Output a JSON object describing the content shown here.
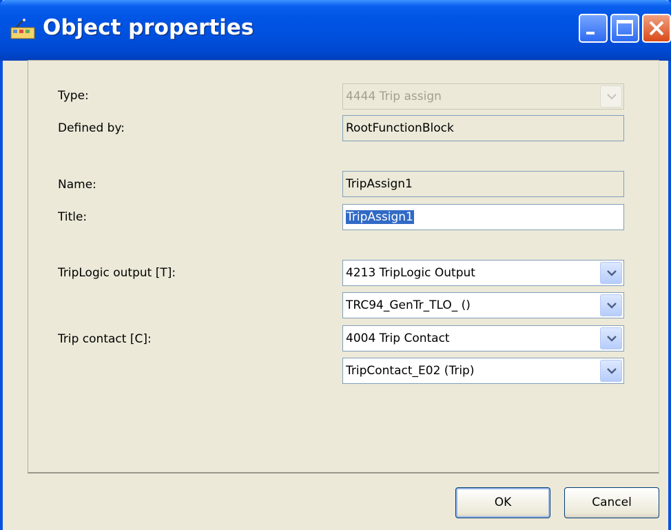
{
  "window": {
    "title": "Object properties",
    "icon": "object-properties-icon"
  },
  "fields": {
    "type": {
      "label": "Type:",
      "value": "4444  Trip assign"
    },
    "defined_by": {
      "label": "Defined by:",
      "value": "RootFunctionBlock"
    },
    "name": {
      "label": "Name:",
      "value": "TripAssign1"
    },
    "title": {
      "label": "Title:",
      "value": "TripAssign1"
    },
    "triplogic_output": {
      "label": "TripLogic output [T]:",
      "type_value": "4213  TripLogic Output",
      "instance_value": "TRC94_GenTr_TLO_ ()"
    },
    "trip_contact": {
      "label": "Trip contact [C]:",
      "type_value": "4004  Trip Contact",
      "instance_value": "TripContact_E02 (Trip)"
    }
  },
  "buttons": {
    "ok": "OK",
    "cancel": "Cancel"
  },
  "colors": {
    "titlebar": "#0055e5",
    "dialog_bg": "#ece9d8",
    "selection": "#316ac5",
    "close_button": "#d94a1a"
  }
}
